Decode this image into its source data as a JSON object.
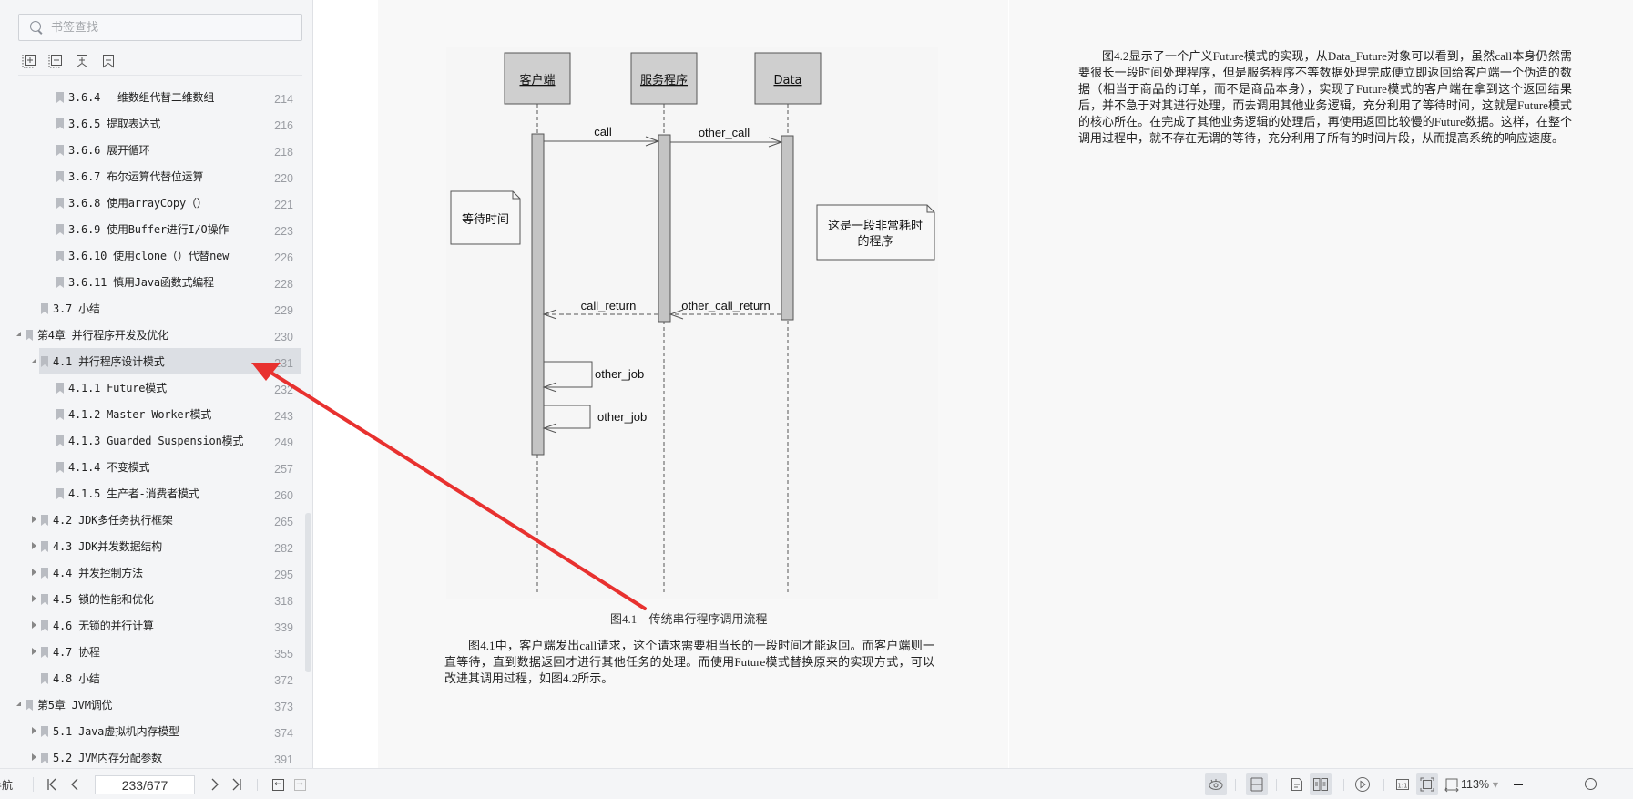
{
  "sidebar": {
    "search_placeholder": "书签查找",
    "toolbar_icons": [
      "expand-all-icon",
      "collapse-all-icon",
      "add-bookmark-icon",
      "remove-bookmark-icon"
    ],
    "items": [
      {
        "level": 3,
        "label": "3.6.4 一维数组代替二维数组",
        "page": "214",
        "toggle": "none"
      },
      {
        "level": 3,
        "label": "3.6.5 提取表达式",
        "page": "216",
        "toggle": "none"
      },
      {
        "level": 3,
        "label": "3.6.6 展开循环",
        "page": "218",
        "toggle": "none"
      },
      {
        "level": 3,
        "label": "3.6.7 布尔运算代替位运算",
        "page": "220",
        "toggle": "none"
      },
      {
        "level": 3,
        "label": "3.6.8 使用arrayCopy（）",
        "page": "221",
        "toggle": "none"
      },
      {
        "level": 3,
        "label": "3.6.9 使用Buffer进行I/O操作",
        "page": "223",
        "toggle": "none"
      },
      {
        "level": 3,
        "label": "3.6.10 使用clone（）代替new",
        "page": "226",
        "toggle": "none"
      },
      {
        "level": 3,
        "label": "3.6.11 慎用Java函数式编程",
        "page": "228",
        "toggle": "none"
      },
      {
        "level": 2,
        "label": "3.7 小结",
        "page": "229",
        "toggle": "none"
      },
      {
        "level": 1,
        "label": "第4章 并行程序开发及优化",
        "page": "230",
        "toggle": "open"
      },
      {
        "level": 2,
        "label": "4.1 并行程序设计模式",
        "page": "231",
        "toggle": "open",
        "active": true
      },
      {
        "level": 3,
        "label": "4.1.1 Future模式",
        "page": "232",
        "toggle": "none"
      },
      {
        "level": 3,
        "label": "4.1.2 Master-Worker模式",
        "page": "243",
        "toggle": "none"
      },
      {
        "level": 3,
        "label": "4.1.3 Guarded Suspension模式",
        "page": "249",
        "toggle": "none"
      },
      {
        "level": 3,
        "label": "4.1.4 不变模式",
        "page": "257",
        "toggle": "none"
      },
      {
        "level": 3,
        "label": "4.1.5 生产者-消费者模式",
        "page": "260",
        "toggle": "none"
      },
      {
        "level": 2,
        "label": "4.2 JDK多任务执行框架",
        "page": "265",
        "toggle": "closed"
      },
      {
        "level": 2,
        "label": "4.3 JDK并发数据结构",
        "page": "282",
        "toggle": "closed"
      },
      {
        "level": 2,
        "label": "4.4 并发控制方法",
        "page": "295",
        "toggle": "closed"
      },
      {
        "level": 2,
        "label": "4.5 锁的性能和优化",
        "page": "318",
        "toggle": "closed"
      },
      {
        "level": 2,
        "label": "4.6 无锁的并行计算",
        "page": "339",
        "toggle": "closed"
      },
      {
        "level": 2,
        "label": "4.7 协程",
        "page": "355",
        "toggle": "closed"
      },
      {
        "level": 2,
        "label": "4.8 小结",
        "page": "372",
        "toggle": "none"
      },
      {
        "level": 1,
        "label": "第5章 JVM调优",
        "page": "373",
        "toggle": "open"
      },
      {
        "level": 2,
        "label": "5.1 Java虚拟机内存模型",
        "page": "374",
        "toggle": "closed"
      },
      {
        "level": 2,
        "label": "5.2 JVM内存分配参数",
        "page": "391",
        "toggle": "closed"
      }
    ]
  },
  "document": {
    "diagram": {
      "lifelines": [
        "客户端",
        "服务程序",
        "Data"
      ],
      "messages": [
        {
          "label": "call",
          "from": "客户端",
          "to": "服务程序",
          "style": "solid"
        },
        {
          "label": "other_call",
          "from": "服务程序",
          "to": "Data",
          "style": "solid"
        },
        {
          "label": "call_return",
          "from": "服务程序",
          "to": "客户端",
          "style": "dashed"
        },
        {
          "label": "other_call_return",
          "from": "Data",
          "to": "服务程序",
          "style": "dashed"
        },
        {
          "label": "other_job",
          "from": "客户端",
          "to": "客户端",
          "style": "self"
        },
        {
          "label": "other_job",
          "from": "客户端",
          "to": "客户端",
          "style": "self"
        }
      ],
      "notes": [
        "等待时间",
        "这是一段非常耗时",
        "的程序"
      ]
    },
    "caption": "图4.1 传统串行程序调用流程",
    "paragraph1": "图4.1中，客户端发出call请求，这个请求需要相当长的一段时间才能返回。而客户端则一直等待，直到数据返回才进行其他任务的处理。而使用Future模式替换原来的实现方式，可以改进其调用过程，如图4.2所示。",
    "paragraph2": "图4.2显示了一个广义Future模式的实现，从Data_Future对象可以看到，虽然call本身仍然需要很长一段时间处理程序，但是服务程序不等数据处理完成便立即返回给客户端一个伪造的数据（相当于商品的订单，而不是商品本身），实现了Future模式的客户端在拿到这个返回结果后，并不急于对其进行处理，而去调用其他业务逻辑，充分利用了等待时间，这就是Future模式的核心所在。在完成了其他业务逻辑的处理后，再使用返回比较慢的Future数据。这样，在整个调用过程中，就不存在无谓的等待，充分利用了所有的时间片段，从而提高系统的响应速度。",
    "annotation_color": "#e8312f"
  },
  "bottombar": {
    "nav_label": "导航",
    "page_indicator": "233/677",
    "zoom_level": "113%",
    "zoom_slider_fraction": 0.57
  }
}
